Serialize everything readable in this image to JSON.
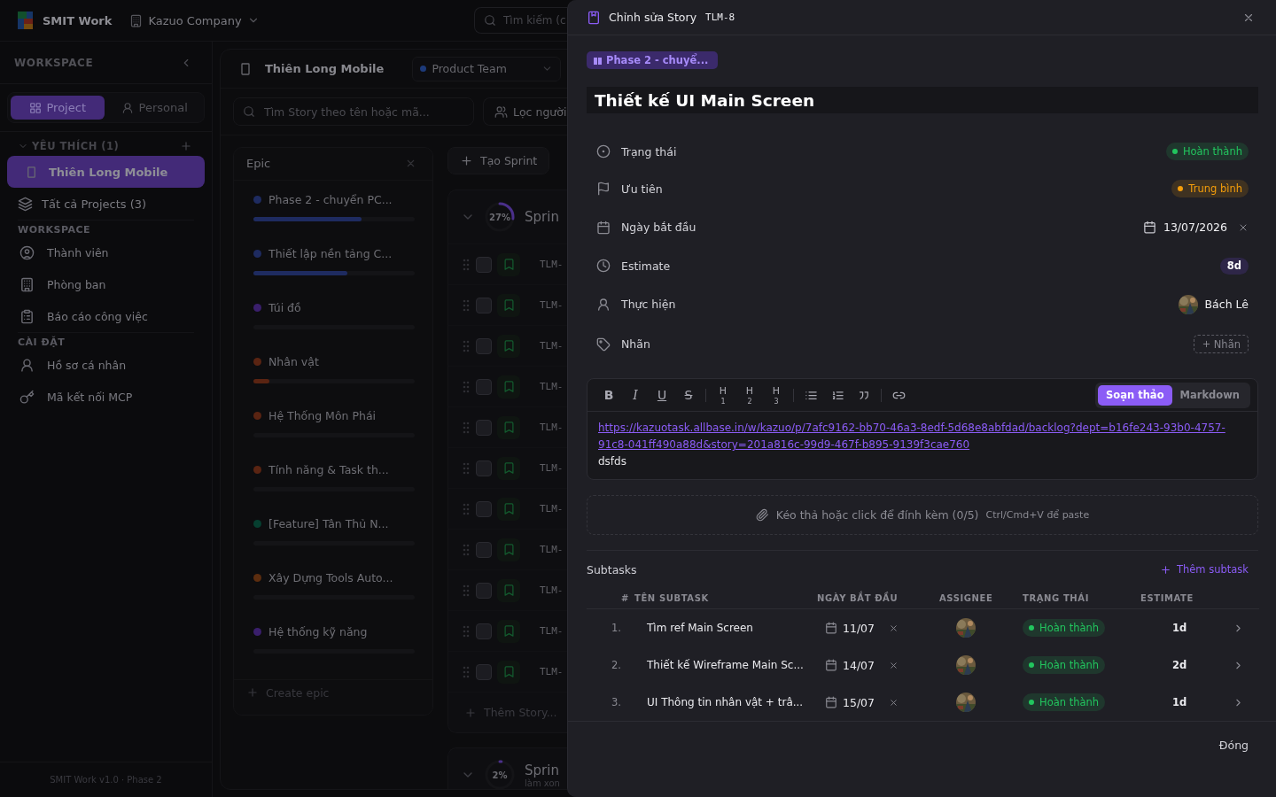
{
  "topbar": {
    "app_name": "SMIT Work",
    "company": "Kazuo Company",
    "search": {
      "placeholder": "Tìm kiếm (c"
    }
  },
  "sidebar": {
    "header": "WORKSPACE",
    "modes": [
      {
        "label": "Project",
        "selected": true
      },
      {
        "label": "Personal",
        "selected": false
      }
    ],
    "favorites": {
      "title": "YÊU THÍCH (1)",
      "items": [
        {
          "label": "Thiên Long Mobile",
          "selected": true
        }
      ]
    },
    "all_projects": "Tất cả Projects (3)",
    "sections": [
      {
        "title": "WORKSPACE",
        "items": [
          {
            "label": "Thành viên"
          },
          {
            "label": "Phòng ban"
          },
          {
            "label": "Báo cáo công việc"
          }
        ]
      },
      {
        "title": "CÀI ĐẶT",
        "items": [
          {
            "label": "Hồ sơ cá nhân"
          },
          {
            "label": "Mã kết nối MCP"
          }
        ]
      }
    ],
    "footer": "SMIT Work v1.0 · Phase 2"
  },
  "project": {
    "name": "Thiên Long Mobile",
    "team": "Product Team",
    "search": {
      "placeholder": "Tìm Story theo tên hoặc mã..."
    },
    "filter": "Lọc người",
    "epics": {
      "title": "Epic",
      "items": [
        {
          "name": "Phase 2 - chuyển PC...",
          "color": "#1e2b60",
          "level": 0.67
        },
        {
          "name": "Thiết lập nền tảng C...",
          "color": "#1e2b60",
          "level": 0.58
        },
        {
          "name": "Túi đồ",
          "color": "#3a1f6c",
          "level": 0
        },
        {
          "name": "Nhân vật",
          "color": "#5a2412",
          "level": 0.1
        },
        {
          "name": "Hệ Thống Môn Phái",
          "color": "#5a2412",
          "level": 0
        },
        {
          "name": "Tính năng & Task th...",
          "color": "#5a2412",
          "level": 0
        },
        {
          "name": "[Feature] Tân Thủ N...",
          "color": "#063f30",
          "level": 0
        },
        {
          "name": "Xây Dựng Tools Auto...",
          "color": "#5c2d0f",
          "level": 0
        },
        {
          "name": "Hệ thống kỹ năng",
          "color": "#3a1f6c",
          "level": 0
        }
      ],
      "create": "Create epic"
    },
    "create_sprint": "Tạo Sprint",
    "sprints": [
      {
        "percent": "27%",
        "level": 0.27,
        "title": "Sprin",
        "stories": [
          {
            "key": "TLM-",
            "checked": false
          },
          {
            "key": "TLM-",
            "checked": false
          },
          {
            "key": "TLM-",
            "checked": false
          },
          {
            "key": "TLM-",
            "checked": false
          },
          {
            "key": "TLM-",
            "checked": false
          },
          {
            "key": "TLM-",
            "checked": false
          },
          {
            "key": "TLM-",
            "checked": false
          },
          {
            "key": "TLM-",
            "checked": false
          },
          {
            "key": "TLM-",
            "checked": false
          },
          {
            "key": "TLM-",
            "checked": false
          },
          {
            "key": "TLM-",
            "checked": false
          }
        ],
        "add_story": "Thêm Story..."
      },
      {
        "percent": "2%",
        "level": 0.02,
        "title": "Sprin",
        "subtitle": "làm xon"
      }
    ]
  },
  "drawer": {
    "title": "Chỉnh sửa Story",
    "key": "TLM-8",
    "epic_tag": "Phase 2 - chuyể...",
    "story_title": "Thiết kế UI Main Screen",
    "properties": [
      {
        "kind": "status",
        "label": "Trạng thái",
        "value": "Hoàn thành",
        "color": "#22c55e"
      },
      {
        "kind": "status",
        "label": "Ưu tiên",
        "value": "Trung bình",
        "color": "#f59e0b"
      },
      {
        "kind": "date",
        "label": "Ngày bắt đầu",
        "value": "13/07/2026"
      },
      {
        "kind": "chip",
        "label": "Estimate",
        "value": "8d"
      },
      {
        "kind": "assignee",
        "label": "Thực hiện",
        "value": "Bách Lê"
      },
      {
        "kind": "tags",
        "label": "Nhãn",
        "value": "Nhãn"
      }
    ],
    "editor": {
      "toolbar": [
        [
          {
            "kind": "bold",
            "label": "B"
          },
          {
            "kind": "italic",
            "label": "I"
          },
          {
            "kind": "underline",
            "label": "U"
          },
          {
            "kind": "strike",
            "label": "S"
          }
        ],
        [
          {
            "kind": "heading",
            "label": "H$_{1}$"
          },
          {
            "kind": "heading",
            "label": "H$_{2}$"
          },
          {
            "kind": "heading",
            "label": "H$_{3}$"
          }
        ],
        [
          {
            "kind": "bullet-list"
          },
          {
            "kind": "numbered-list"
          },
          {
            "kind": "quote"
          }
        ],
        [
          {
            "kind": "link"
          }
        ]
      ],
      "modes": [
        {
          "label": "Soạn thảo",
          "selected": true
        },
        {
          "label": "Markdown",
          "selected": false
        }
      ],
      "link": "https://kazuotask.allbase.in/w/kazuo/p/7afc9162-bb70-46a3-8edf-5d68e8abfdad/backlog?dept=b16fe243-93b0-4757-91c8-041ff490a88d&story=201a816c-99d9-467f-b895-9139f3cae760",
      "text": "dsfds"
    },
    "attachments": {
      "hint": "Kéo thả hoặc click để đính kèm (0/5)",
      "paste_hint": "Ctrl/Cmd+V để paste"
    },
    "subtasks": {
      "title": "Subtasks",
      "add": "Thêm subtask",
      "columns": [
        "#",
        "TÊN SUBTASK",
        "NGÀY BẮT ĐẦU",
        "ASSIGNEE",
        "TRẠNG THÁI",
        "ESTIMATE"
      ],
      "rows": [
        {
          "index": "1.",
          "name": "Tìm ref Main Screen",
          "date": "11/07",
          "status": "Hoàn thành",
          "estimate": "1d"
        },
        {
          "index": "2.",
          "name": "Thiết kế Wireframe Main Sc...",
          "date": "14/07",
          "status": "Hoàn thành",
          "estimate": "2d"
        },
        {
          "index": "3.",
          "name": "UI Thông tin nhân vật + trâ...",
          "date": "15/07",
          "status": "Hoàn thành",
          "estimate": "1d"
        }
      ]
    },
    "close": "Đóng"
  }
}
